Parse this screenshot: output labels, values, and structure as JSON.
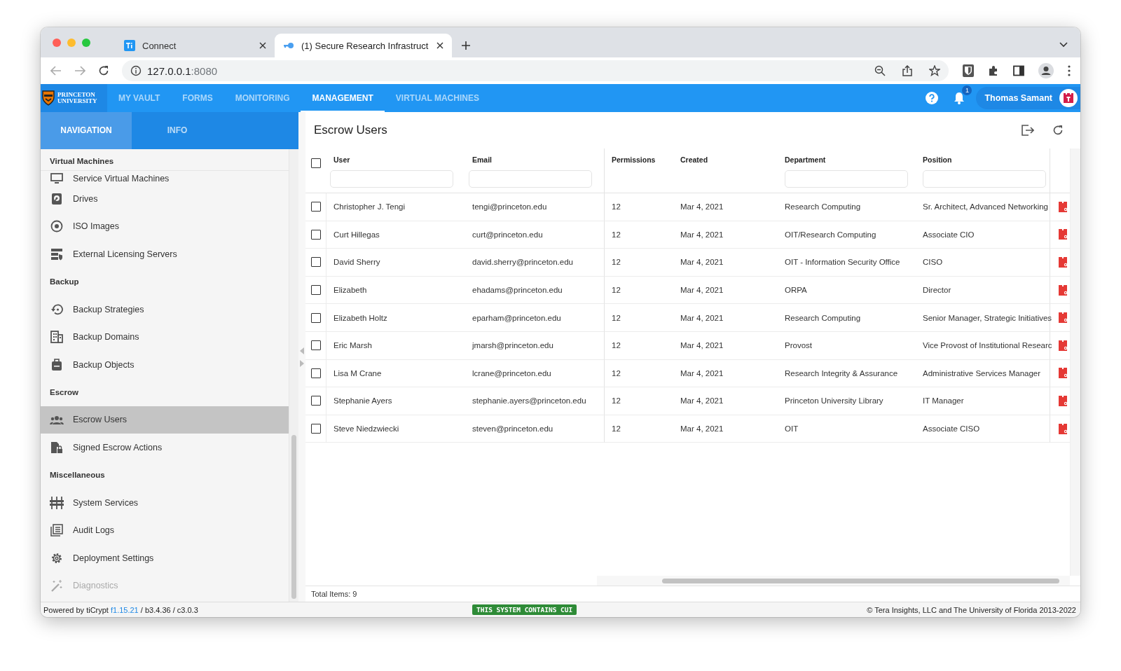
{
  "browser": {
    "tabs": [
      {
        "title": "Connect",
        "kind": "ti",
        "selected": false
      },
      {
        "title": "(1) Secure Research Infrastruct",
        "kind": "key",
        "selected": true
      }
    ],
    "url_host": "127.0.0.1",
    "url_port": ":8080"
  },
  "app_bar": {
    "logo": [
      "PRINCETON",
      "UNIVERSITY"
    ],
    "menu": [
      {
        "label": "MY VAULT",
        "selected": false
      },
      {
        "label": "FORMS",
        "selected": false
      },
      {
        "label": "MONITORING",
        "selected": false
      },
      {
        "label": "MANAGEMENT",
        "selected": true
      },
      {
        "label": "VIRTUAL MACHINES",
        "selected": false
      }
    ],
    "notification_count": "1",
    "user_name": "Thomas Samant"
  },
  "sidebar": {
    "tabs": [
      {
        "label": "NAVIGATION",
        "selected": true
      },
      {
        "label": "INFO",
        "selected": false
      }
    ],
    "sections": [
      {
        "title": "Virtual Machines",
        "items": [
          {
            "label": "Service Virtual Machines",
            "kind": "monitor",
            "selected": false,
            "disabled": false
          },
          {
            "label": "Drives",
            "kind": "drive",
            "selected": false,
            "disabled": false
          },
          {
            "label": "ISO Images",
            "kind": "disc",
            "selected": false,
            "disabled": false
          },
          {
            "label": "External Licensing Servers",
            "kind": "server",
            "selected": false,
            "disabled": false
          }
        ]
      },
      {
        "title": "Backup",
        "items": [
          {
            "label": "Backup Strategies",
            "kind": "restore",
            "selected": false,
            "disabled": false
          },
          {
            "label": "Backup Domains",
            "kind": "building",
            "selected": false,
            "disabled": false
          },
          {
            "label": "Backup Objects",
            "kind": "bag",
            "selected": false,
            "disabled": false
          }
        ]
      },
      {
        "title": "Escrow",
        "items": [
          {
            "label": "Escrow Users",
            "kind": "people",
            "selected": true,
            "disabled": false
          },
          {
            "label": "Signed Escrow Actions",
            "kind": "filelock",
            "selected": false,
            "disabled": false
          }
        ]
      },
      {
        "title": "Miscellaneous",
        "items": [
          {
            "label": "System Services",
            "kind": "sliders",
            "selected": false,
            "disabled": false
          },
          {
            "label": "Audit Logs",
            "kind": "log",
            "selected": false,
            "disabled": false
          },
          {
            "label": "Deployment Settings",
            "kind": "gear",
            "selected": false,
            "disabled": false
          },
          {
            "label": "Diagnostics",
            "kind": "wand",
            "selected": false,
            "disabled": true
          }
        ]
      }
    ]
  },
  "content": {
    "title": "Escrow Users",
    "table": {
      "all_checked": false,
      "columns": [
        {
          "label": "User",
          "filter": true
        },
        {
          "label": "Email",
          "filter": true
        },
        {
          "label": "Permissions",
          "filter": false
        },
        {
          "label": "Created",
          "filter": false
        },
        {
          "label": "Department",
          "filter": true
        },
        {
          "label": "Position",
          "filter": true
        }
      ],
      "rows": [
        {
          "checked": false,
          "cells": [
            "Christopher J. Tengi",
            "tengi@princeton.edu",
            "12",
            "Mar 4, 2021",
            "Research Computing",
            "Sr. Architect, Advanced Networking"
          ]
        },
        {
          "checked": false,
          "cells": [
            "Curt Hillegas",
            "curt@princeton.edu",
            "12",
            "Mar 4, 2021",
            "OIT/Research Computing",
            "Associate CIO"
          ]
        },
        {
          "checked": false,
          "cells": [
            "David Sherry",
            "david.sherry@princeton.edu",
            "12",
            "Mar 4, 2021",
            "OIT - Information Security Office",
            "CISO"
          ]
        },
        {
          "checked": false,
          "cells": [
            "Elizabeth",
            "ehadams@princeton.edu",
            "12",
            "Mar 4, 2021",
            "ORPA",
            "Director"
          ]
        },
        {
          "checked": false,
          "cells": [
            "Elizabeth Holtz",
            "eparham@princeton.edu",
            "12",
            "Mar 4, 2021",
            "Research Computing",
            "Senior Manager, Strategic Initiatives"
          ]
        },
        {
          "checked": false,
          "cells": [
            "Eric Marsh",
            "jmarsh@princeton.edu",
            "12",
            "Mar 4, 2021",
            "Provost",
            "Vice Provost of Institutional Researc"
          ]
        },
        {
          "checked": false,
          "cells": [
            "Lisa M Crane",
            "lcrane@princeton.edu",
            "12",
            "Mar 4, 2021",
            "Research Integrity & Assurance",
            "Administrative Services Manager"
          ]
        },
        {
          "checked": false,
          "cells": [
            "Stephanie Ayers",
            "stephanie.ayers@princeton.edu",
            "12",
            "Mar 4, 2021",
            "Princeton University Library",
            "IT Manager"
          ]
        },
        {
          "checked": false,
          "cells": [
            "Steve Niedzwiecki",
            "steven@princeton.edu",
            "12",
            "Mar 4, 2021",
            "OIT",
            "Associate CISO"
          ]
        }
      ]
    },
    "total": "Total Items: 9"
  },
  "footer": {
    "powered": "Powered by tiCrypt",
    "version": "f1.15.21",
    "build": " / b3.4.36 / c3.0.3",
    "banner": "THIS SYSTEM CONTAINS CUI",
    "copyright": "© Tera Insights, LLC and The University of Florida 2013-2022"
  }
}
